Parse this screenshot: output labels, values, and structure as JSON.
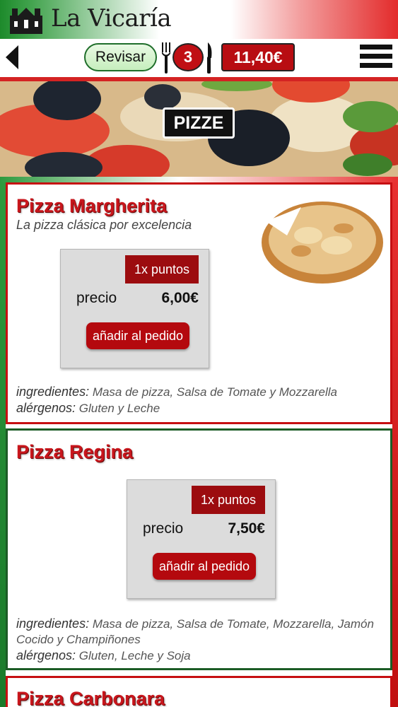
{
  "header": {
    "app_title": "La Vicaría",
    "logo_icon": "church-icon"
  },
  "toolbar": {
    "back_icon": "back-arrow-icon",
    "review_label": "Revisar",
    "order_count": "3",
    "order_total": "11,40€",
    "menu_icon": "hamburger-menu-icon"
  },
  "banner": {
    "category_title": "PIZZE"
  },
  "products": [
    {
      "name": "Pizza Margherita",
      "subtitle": "La pizza clásica por excelencia",
      "points": "1x puntos",
      "price_label": "precio",
      "price": "6,00€",
      "add_label": "añadir al pedido",
      "ingredients_label": "ingredientes:",
      "ingredients": "Masa de pizza, Salsa de Tomate y Mozzarella",
      "allergens_label": "alérgenos:",
      "allergens": "Gluten y Leche"
    },
    {
      "name": "Pizza Regina",
      "points": "1x puntos",
      "price_label": "precio",
      "price": "7,50€",
      "add_label": "añadir al pedido",
      "ingredients_label": "ingredientes:",
      "ingredients": "Masa de pizza, Salsa de Tomate, Mozzarella, Jamón Cocido y Champiñones",
      "allergens_label": "alérgenos:",
      "allergens": "Gluten, Leche y Soja"
    },
    {
      "name": "Pizza Carbonara"
    }
  ],
  "colors": {
    "brand_red": "#c60f12",
    "brand_green": "#1d8a2b",
    "review_green": "#c6eebd"
  }
}
